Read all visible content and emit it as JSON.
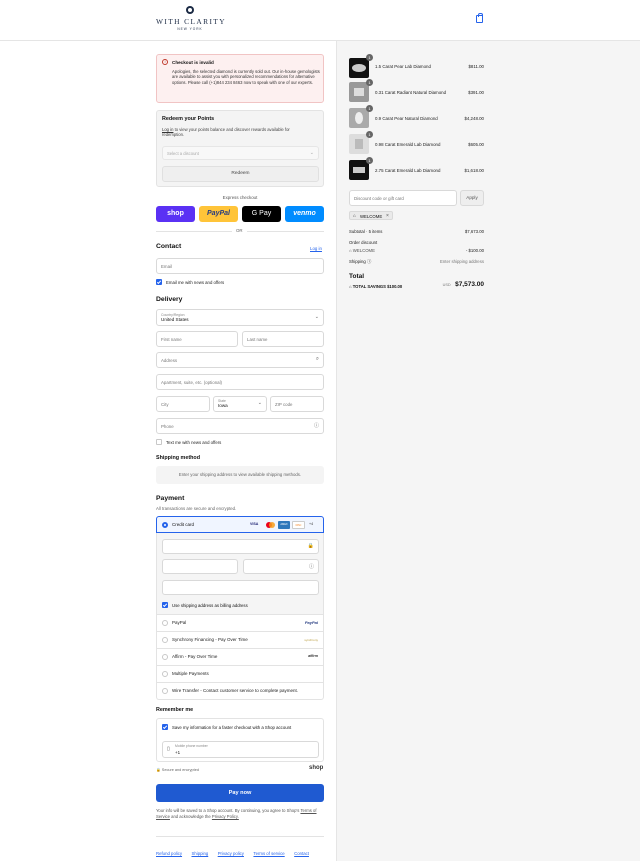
{
  "brand": {
    "name": "WITH CLARITY",
    "sub": "NEW YORK"
  },
  "alert": {
    "title": "Checkout is invalid",
    "body": "Apologies, the selected diamond is currently sold out. Our in-house gemologists are available to assist you with personalized recommendations for alternative options. Please call (+1)844 234 8463 now to speak with one of our experts."
  },
  "points": {
    "title": "Redeem your Points",
    "login": "Log in",
    "desc": "to view your points balance and discover rewards available for redemption.",
    "select_placeholder": "Select a discount",
    "redeem_label": "Redeem"
  },
  "express": {
    "label": "Express checkout",
    "shop": "shop",
    "paypal": "PayPal",
    "gpay": "G Pay",
    "venmo": "venmo",
    "or": "OR"
  },
  "contact": {
    "title": "Contact",
    "login": "Log in",
    "email_placeholder": "Email",
    "news_label": "Email me with news and offers"
  },
  "delivery": {
    "title": "Delivery",
    "country_label": "Country/Region",
    "country_value": "United States",
    "first_name": "First name",
    "last_name": "Last name",
    "address": "Address",
    "apartment": "Apartment, suite, etc. (optional)",
    "city": "City",
    "state_label": "State",
    "state_value": "Iowa",
    "zip": "ZIP code",
    "phone": "Phone",
    "text_label": "Text me with news and offers"
  },
  "shipping": {
    "title": "Shipping method",
    "placeholder": "Enter your shipping address to view available shipping methods."
  },
  "payment": {
    "title": "Payment",
    "subtitle": "All transactions are secure and encrypted.",
    "credit_card": "Credit card",
    "card_brands": [
      "VISA",
      "MC",
      "AMEX",
      "DISC",
      "+4"
    ],
    "billing_label": "Use shipping address as billing address",
    "methods": [
      {
        "label": "PayPal",
        "logo": "PayPal"
      },
      {
        "label": "Synchrony Financing - Pay Over Time",
        "logo": "synchrony"
      },
      {
        "label": "Affirm - Pay Over Time",
        "logo": "affirm"
      },
      {
        "label": "Multiple Payments",
        "logo": ""
      },
      {
        "label": "Wire Transfer - Contact customer service to complete payment.",
        "logo": ""
      }
    ]
  },
  "remember": {
    "title": "Remember me",
    "save_label": "Save my information for a faster checkout with a Shop account",
    "phone_label": "Mobile phone number",
    "phone_value": "+1",
    "secure": "Secure and encrypted",
    "shop": "shop"
  },
  "pay_now": "Pay now",
  "legal": {
    "text": "Your info will be saved to a Shop account. By continuing, you agree to Shop's",
    "terms": "Terms of Service",
    "and": "and acknowledge the",
    "privacy": "Privacy Policy."
  },
  "footer": [
    "Refund policy",
    "Shipping",
    "Privacy policy",
    "Terms of service",
    "Contact"
  ],
  "cart": {
    "items": [
      {
        "qty": "1",
        "name": "1.5 Carat Pear Lab Diamond",
        "price": "$811.00"
      },
      {
        "qty": "1",
        "name": "0.31 Carat Radiant Natural Diamond",
        "price": "$391.00"
      },
      {
        "qty": "1",
        "name": "0.9 Carat Pear Natural Diamond",
        "price": "$4,248.00"
      },
      {
        "qty": "1",
        "name": "0.98 Carat Emerald Lab Diamond",
        "price": "$605.00"
      },
      {
        "qty": "1",
        "name": "2.75 Carat Emerald Lab Diamond",
        "price": "$1,618.00"
      }
    ],
    "discount_placeholder": "Discount code or gift card",
    "apply": "Apply",
    "code": "WELCOME",
    "subtotal_label": "Subtotal · 5 items",
    "subtotal": "$7,673.00",
    "order_discount": "Order discount",
    "discount_code": "WELCOME",
    "discount_value": "- $100.00",
    "shipping_label": "Shipping",
    "shipping_value": "Enter shipping address",
    "total_label": "Total",
    "currency": "USD",
    "total": "$7,573.00",
    "savings_label": "TOTAL SAVINGS",
    "savings": "$100.00"
  },
  "colors": {
    "accent": "#2563eb",
    "shop_purple": "#5a31f4",
    "paypal_yellow": "#ffc439",
    "venmo_blue": "#008cff",
    "alert_bg": "#fdf0f0"
  }
}
